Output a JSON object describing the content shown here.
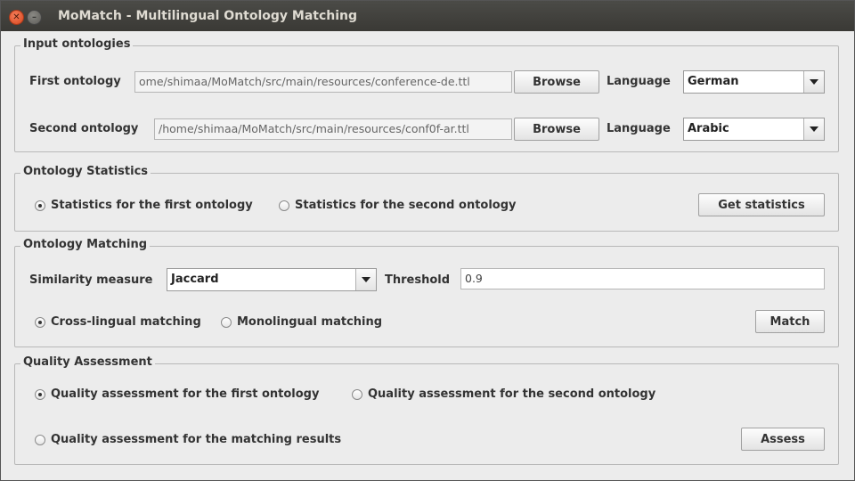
{
  "window": {
    "title": "MoMatch - Multilingual Ontology Matching"
  },
  "input": {
    "legend": "Input ontologies",
    "first_label": "First ontology",
    "first_path": "ome/shimaa/MoMatch/src/main/resources/conference-de.ttl",
    "second_label": "Second ontology",
    "second_path": "/home/shimaa/MoMatch/src/main/resources/conf0f-ar.ttl",
    "browse_label": "Browse",
    "language_label": "Language",
    "first_language": "German",
    "second_language": "Arabic"
  },
  "statistics": {
    "legend": "Ontology Statistics",
    "first_option": "Statistics for the first ontology",
    "second_option": "Statistics for the second ontology",
    "button": "Get statistics",
    "selected": "first"
  },
  "matching": {
    "legend": "Ontology Matching",
    "similarity_label": "Similarity measure",
    "similarity_value": "Jaccard",
    "threshold_label": "Threshold",
    "threshold_value": "0.9",
    "cross_option": "Cross-lingual matching",
    "mono_option": "Monolingual matching",
    "button": "Match",
    "selected": "cross"
  },
  "quality": {
    "legend": "Quality Assessment",
    "first_option": "Quality assessment for the first ontology",
    "second_option": "Quality assessment for the second ontology",
    "results_option": "Quality assessment for the matching results",
    "button": "Assess",
    "selected": "first"
  },
  "icons": {
    "close": "close-icon",
    "minimize": "minimize-icon",
    "dropdown": "chevron-down-icon"
  }
}
